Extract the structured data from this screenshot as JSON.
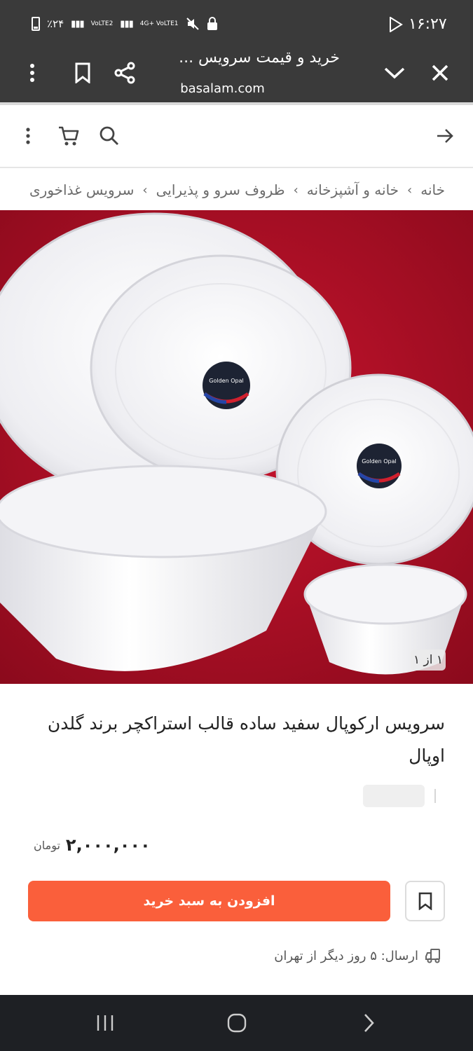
{
  "status_bar": {
    "time": "۱۶:۲۷",
    "battery": "٪۲۴",
    "network_1": "VoLTE2",
    "network_2": "4G+ VoLTE1"
  },
  "browser": {
    "page_title": "خرید و قیمت سرویس ...",
    "url": "basalam.com"
  },
  "breadcrumb": {
    "items": [
      "خانه",
      "خانه و آشپزخانه",
      "ظروف سرو و پذیرایی",
      "سرویس غذاخوری"
    ]
  },
  "gallery": {
    "counter": "۱ از ۱",
    "logo_text": "Golden Opal"
  },
  "product": {
    "title": "سرویس ارکوپال سفید ساده قالب استراکچر برند گلدن اوپال",
    "price": "۲,۰۰۰,۰۰۰",
    "currency": "تومان"
  },
  "actions": {
    "add_to_cart": "افزودن به سبد خرید"
  },
  "shipping": {
    "text": "ارسال: ۵ روز دیگر از تهران"
  },
  "colors": {
    "accent": "#fa5f3b",
    "chrome": "#3a3a3a",
    "navbar": "#1e2024",
    "backdrop": "#b0102a"
  }
}
